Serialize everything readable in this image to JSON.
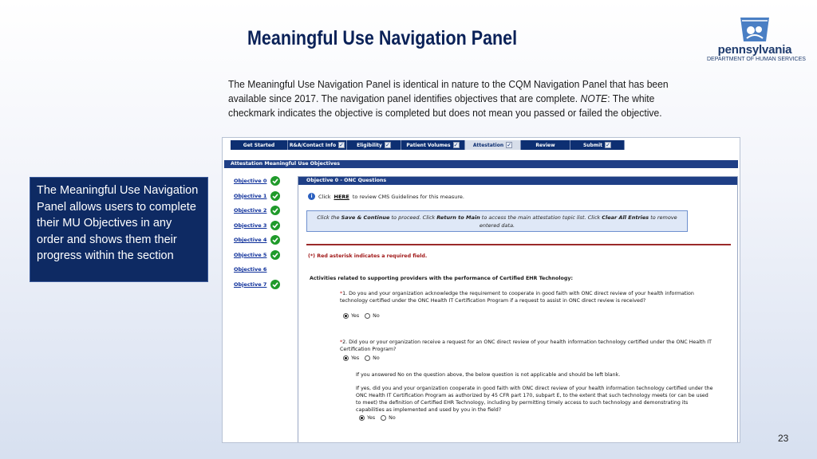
{
  "slide": {
    "title": "Meaningful Use Navigation Panel",
    "intro_part1": "The Meaningful Use Navigation Panel is identical in nature to the CQM Navigation Panel that has been available since 2017. The navigation panel identifies objectives that are complete. ",
    "intro_note": "NOTE",
    "intro_part2": ": The white checkmark indicates the objective is completed but does not mean you passed or failed the objective.",
    "callout": "The Meaningful Use Navigation Panel allows users to complete their MU Objectives in any order and shows them their progress within the section",
    "page_number": "23",
    "logo_word": "pennsylvania",
    "logo_sub": "DEPARTMENT OF HUMAN SERVICES"
  },
  "tabs": [
    {
      "label": "Get Started",
      "checked": false
    },
    {
      "label": "R&A/Contact Info",
      "checked": true
    },
    {
      "label": "Eligibility",
      "checked": true
    },
    {
      "label": "Patient Volumes",
      "checked": true
    },
    {
      "label": "Attestation",
      "checked": true,
      "active": true
    },
    {
      "label": "Review",
      "checked": false
    },
    {
      "label": "Submit",
      "checked": true
    }
  ],
  "screen": {
    "section_header": "Attestation Meaningful Use Objectives",
    "objectives": [
      {
        "label": "Objective 0",
        "complete": true
      },
      {
        "label": "Objective 1",
        "complete": true
      },
      {
        "label": "Objective 2",
        "complete": true
      },
      {
        "label": "Objective 3",
        "complete": true
      },
      {
        "label": "Objective 4",
        "complete": true
      },
      {
        "label": "Objective 5",
        "complete": true
      },
      {
        "label": "Objective 6",
        "complete": false
      },
      {
        "label": "Objective 7",
        "complete": true
      }
    ],
    "panel_header": "Objective 0 - ONC Questions",
    "click_prefix": "Click",
    "here_link": "HERE",
    "click_suffix": "to review CMS Guidelines for this measure.",
    "notice_1": "Click the",
    "notice_save": "Save & Continue",
    "notice_2": "to proceed. Click",
    "notice_return": "Return to Main",
    "notice_3": "to access the main attestation topic list. Click",
    "notice_clear": "Clear All Entries",
    "notice_4": "to remove entered data.",
    "required": "(*) Red asterisk indicates a required field.",
    "activities": "Activities related to supporting providers with the performance of Certified EHR Technology:",
    "q1": "1. Do you and your organization acknowledge the requirement to cooperate in good faith with ONC direct review of your health information technology certified under the ONC Health IT Certification Program if a request to assist in ONC direct review is received?",
    "q2": "2. Did you or your organization receive a request for an ONC direct review of your health information technology certified under the ONC Health IT Certification Program?",
    "note_if_no": "If you answered No on the question above, the below question is not applicable and should be left blank.",
    "q3": "If yes, did you and your organization cooperate in good faith with ONC direct review of your health information technology certified under the ONC Health IT Certification Program as authorized by 45 CFR part 170, subpart E, to the extent that such technology meets (or can be used to meet) the definition of Certified EHR Technology, including by permitting timely access to such technology and demonstrating its capabilities as implemented and used by you in the field?",
    "yes": "Yes",
    "no": "No",
    "star": "*"
  }
}
